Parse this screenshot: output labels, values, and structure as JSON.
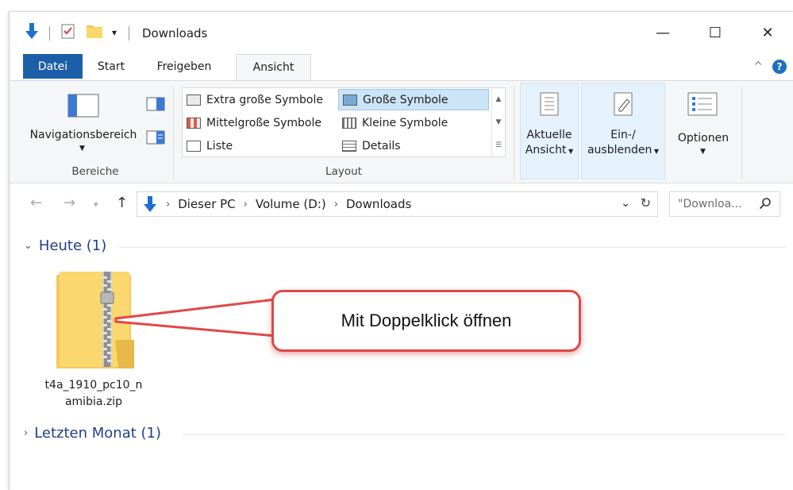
{
  "window": {
    "title": "Downloads"
  },
  "window_controls": {
    "minimize": "—",
    "maximize": "☐",
    "close": "✕"
  },
  "ribbon_tabs": {
    "file": "Datei",
    "start": "Start",
    "share": "Freigeben",
    "view": "Ansicht",
    "collapse_glyph": "^",
    "help_glyph": "?"
  },
  "ribbon": {
    "panes": {
      "navigation_pane": "Navigationsbereich",
      "group_label": "Bereiche"
    },
    "layout": {
      "items": [
        "Extra große Symbole",
        "Mittelgroße Symbole",
        "Liste",
        "Große Symbole",
        "Kleine Symbole",
        "Details"
      ],
      "selected": "Große Symbole",
      "group_label": "Layout"
    },
    "current_view": {
      "line1": "Aktuelle",
      "line2": "Ansicht"
    },
    "show_hide": {
      "line1": "Ein-/",
      "line2": "ausblenden"
    },
    "options": {
      "label": "Optionen"
    }
  },
  "address_bar": {
    "breadcrumb": [
      "Dieser PC",
      "Volume (D:)",
      "Downloads"
    ],
    "search_placeholder": "\"Downloa...",
    "refresh_glyph": "↻"
  },
  "content": {
    "groups": [
      {
        "label": "Heute (1)",
        "expanded": true
      },
      {
        "label": "Letzten Monat (1)",
        "expanded": false
      }
    ],
    "files": [
      {
        "name_line1": "t4a_1910_pc10_n",
        "name_line2": "amibia.zip",
        "icon": "zip-folder-icon"
      }
    ],
    "callout": "Mit Doppelklick öffnen"
  },
  "colors": {
    "file_tab": "#1c5fa8",
    "selection": "#cce4f7",
    "group_header": "#1e3f8a",
    "callout_border": "#e04848"
  }
}
